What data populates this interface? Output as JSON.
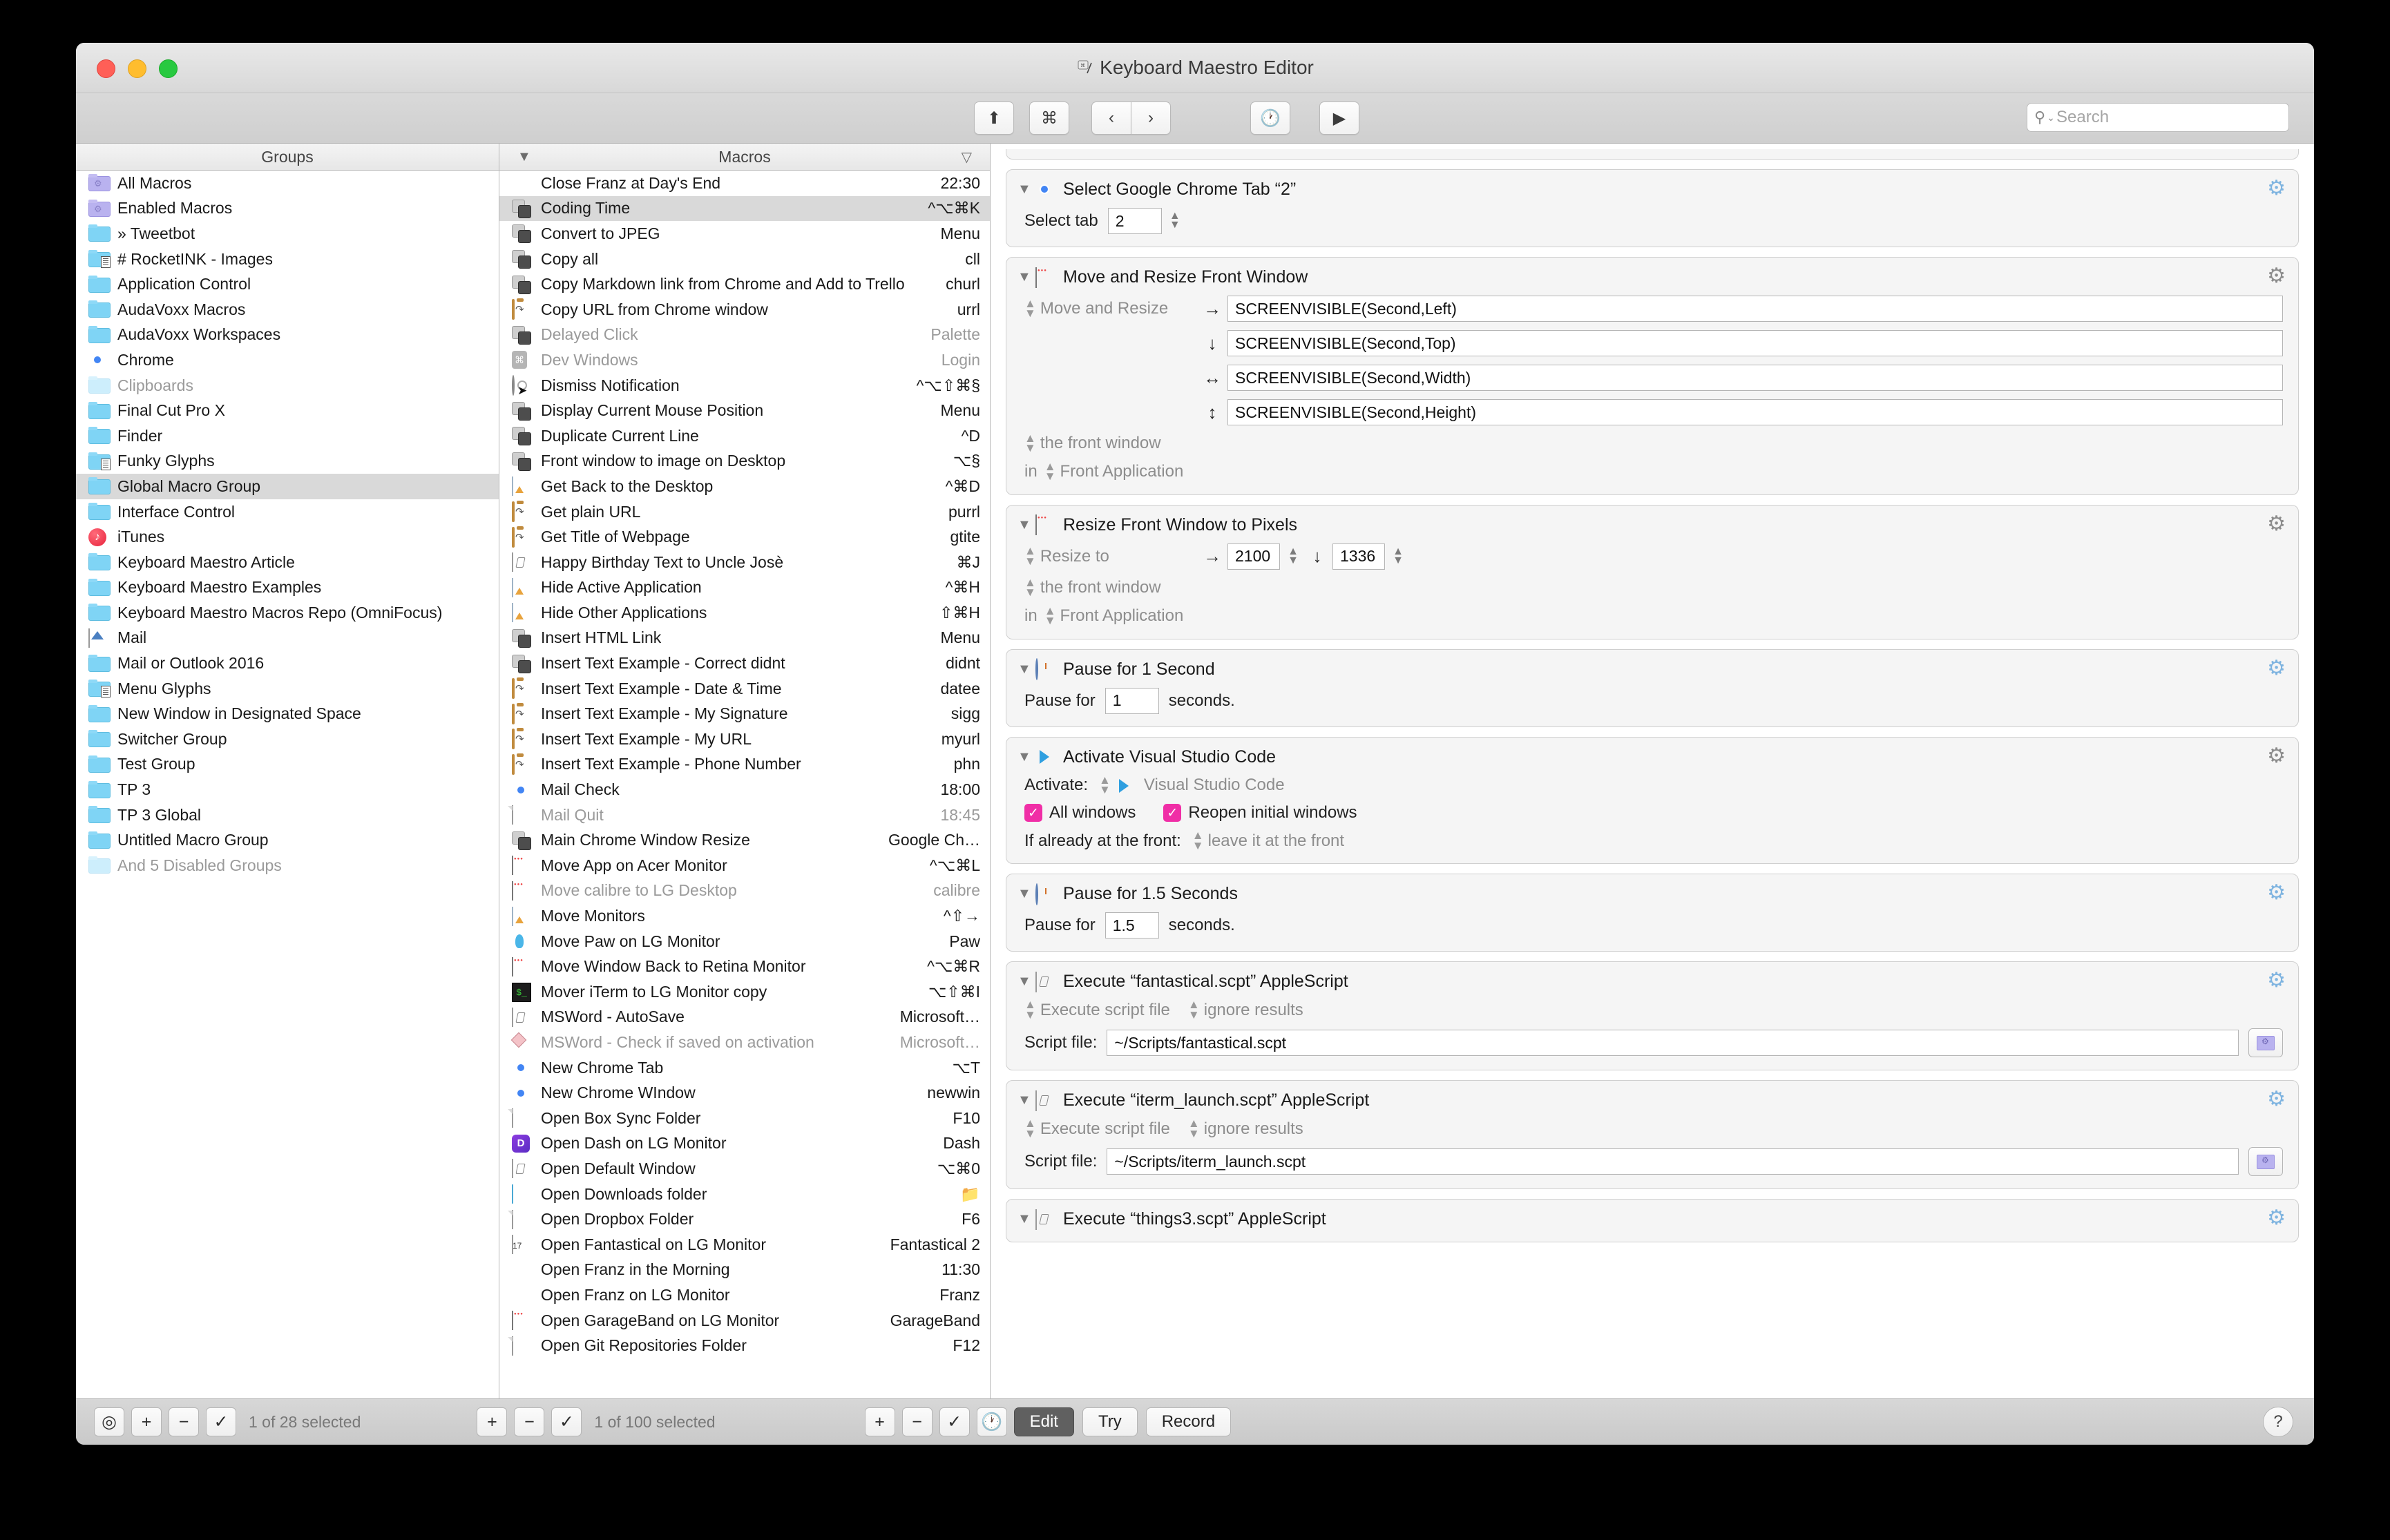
{
  "window": {
    "title": "Keyboard Maestro Editor",
    "app_icon": "keyboard-maestro-icon"
  },
  "toolbar": {
    "share_icon": "share-icon",
    "command_icon": "command-icon",
    "back_icon": "chevron-left-icon",
    "forward_icon": "chevron-right-icon",
    "clock_icon": "clock-icon",
    "play_icon": "play-icon",
    "search": {
      "value": "",
      "placeholder": "Search",
      "icon": "search-icon"
    }
  },
  "groups_column": {
    "header": "Groups",
    "items": [
      {
        "label": "All Macros",
        "icon": "folder-gear-purple",
        "dim": false,
        "selected": false
      },
      {
        "label": "Enabled Macros",
        "icon": "folder-gear-purple",
        "dim": false,
        "selected": false
      },
      {
        "label": "» Tweetbot",
        "icon": "folder-blue",
        "dim": false,
        "selected": false
      },
      {
        "label": "# RocketINK - Images",
        "icon": "folder-blue-doc",
        "dim": false,
        "selected": false
      },
      {
        "label": "Application Control",
        "icon": "folder-blue",
        "dim": false,
        "selected": false
      },
      {
        "label": "AudaVoxx Macros",
        "icon": "folder-blue",
        "dim": false,
        "selected": false
      },
      {
        "label": "AudaVoxx Workspaces",
        "icon": "folder-blue",
        "dim": false,
        "selected": false
      },
      {
        "label": "Chrome",
        "icon": "chrome-icon",
        "dim": false,
        "selected": false
      },
      {
        "label": "Clipboards",
        "icon": "folder-pale",
        "dim": true,
        "selected": false
      },
      {
        "label": "Final Cut Pro X",
        "icon": "folder-blue",
        "dim": false,
        "selected": false
      },
      {
        "label": "Finder",
        "icon": "folder-blue",
        "dim": false,
        "selected": false
      },
      {
        "label": "Funky Glyphs",
        "icon": "folder-blue-doc",
        "dim": false,
        "selected": false
      },
      {
        "label": "Global Macro Group",
        "icon": "folder-blue",
        "dim": false,
        "selected": true
      },
      {
        "label": "Interface Control",
        "icon": "folder-blue",
        "dim": false,
        "selected": false
      },
      {
        "label": "iTunes",
        "icon": "itunes-icon",
        "dim": false,
        "selected": false
      },
      {
        "label": "Keyboard Maestro Article",
        "icon": "folder-blue",
        "dim": false,
        "selected": false
      },
      {
        "label": "Keyboard Maestro Examples",
        "icon": "folder-blue",
        "dim": false,
        "selected": false
      },
      {
        "label": "Keyboard Maestro Macros Repo (OmniFocus)",
        "icon": "folder-blue",
        "dim": false,
        "selected": false
      },
      {
        "label": "Mail",
        "icon": "mail-icon",
        "dim": false,
        "selected": false
      },
      {
        "label": "Mail or Outlook 2016",
        "icon": "folder-blue",
        "dim": false,
        "selected": false
      },
      {
        "label": "Menu Glyphs",
        "icon": "folder-blue-doc",
        "dim": false,
        "selected": false
      },
      {
        "label": "New Window in Designated Space",
        "icon": "folder-blue",
        "dim": false,
        "selected": false
      },
      {
        "label": "Switcher Group",
        "icon": "folder-blue",
        "dim": false,
        "selected": false
      },
      {
        "label": "Test Group",
        "icon": "folder-blue",
        "dim": false,
        "selected": false
      },
      {
        "label": "TP 3",
        "icon": "folder-blue",
        "dim": false,
        "selected": false
      },
      {
        "label": "TP 3 Global",
        "icon": "folder-blue",
        "dim": false,
        "selected": false
      },
      {
        "label": "Untitled Macro Group",
        "icon": "folder-blue",
        "dim": false,
        "selected": false
      },
      {
        "label": "And 5 Disabled Groups",
        "icon": "folder-pale",
        "dim": true,
        "selected": false
      }
    ]
  },
  "macros_column": {
    "header": "Macros",
    "sort_left_icon": "sort-descending-icon",
    "sort_right_icon": "filter-icon",
    "items": [
      {
        "label": "Close Franz at Day's End",
        "trigger": "22:30",
        "icon": "franz-icon",
        "dim": false,
        "selected": false
      },
      {
        "label": "Coding Time",
        "trigger": "^⌥⌘K",
        "icon": "macro-keys-icon",
        "dim": false,
        "selected": true
      },
      {
        "label": "Convert to JPEG",
        "trigger": "Menu",
        "icon": "macro-keys-icon",
        "dim": false,
        "selected": false
      },
      {
        "label": "Copy all",
        "trigger": "cll",
        "icon": "macro-keys-icon",
        "dim": false,
        "selected": false
      },
      {
        "label": "Copy Markdown link from Chrome and Add to Trello",
        "trigger": "churl",
        "icon": "macro-keys-icon",
        "dim": false,
        "selected": false
      },
      {
        "label": "Copy URL from Chrome window",
        "trigger": "urrl",
        "icon": "clipboard-icon",
        "dim": false,
        "selected": false
      },
      {
        "label": "Delayed Click",
        "trigger": "Palette",
        "icon": "macro-keys-icon",
        "dim": true,
        "selected": false
      },
      {
        "label": "Dev Windows",
        "trigger": "Login",
        "icon": "command-key-icon",
        "dim": true,
        "selected": false
      },
      {
        "label": "Dismiss Notification",
        "trigger": "^⌥⇧⌘§",
        "icon": "notification-cursor-icon",
        "dim": false,
        "selected": false
      },
      {
        "label": "Display Current Mouse Position",
        "trigger": "Menu",
        "icon": "macro-keys-icon",
        "dim": false,
        "selected": false
      },
      {
        "label": "Duplicate Current Line",
        "trigger": "^D",
        "icon": "macro-keys-icon",
        "dim": false,
        "selected": false
      },
      {
        "label": "Front window to image on Desktop",
        "trigger": "⌥§",
        "icon": "macro-keys-icon",
        "dim": false,
        "selected": false
      },
      {
        "label": "Get Back to the Desktop",
        "trigger": "^⌘D",
        "icon": "app-icon",
        "dim": false,
        "selected": false
      },
      {
        "label": "Get plain URL",
        "trigger": "purrl",
        "icon": "clipboard-icon",
        "dim": false,
        "selected": false
      },
      {
        "label": "Get Title of Webpage",
        "trigger": "gtite",
        "icon": "clipboard-icon",
        "dim": false,
        "selected": false
      },
      {
        "label": "Happy Birthday Text to Uncle Josè",
        "trigger": "⌘J",
        "icon": "script-icon",
        "dim": false,
        "selected": false
      },
      {
        "label": "Hide Active Application",
        "trigger": "^⌘H",
        "icon": "app-icon",
        "dim": false,
        "selected": false
      },
      {
        "label": "Hide Other Applications",
        "trigger": "⇧⌘H",
        "icon": "app-icon",
        "dim": false,
        "selected": false
      },
      {
        "label": "Insert HTML Link",
        "trigger": "Menu",
        "icon": "macro-keys-icon",
        "dim": false,
        "selected": false
      },
      {
        "label": "Insert Text Example - Correct didnt",
        "trigger": "didnt",
        "icon": "macro-keys-icon",
        "dim": false,
        "selected": false
      },
      {
        "label": "Insert Text Example - Date & Time",
        "trigger": "datee",
        "icon": "clipboard-icon",
        "dim": false,
        "selected": false
      },
      {
        "label": "Insert Text Example - My Signature",
        "trigger": "sigg",
        "icon": "clipboard-icon",
        "dim": false,
        "selected": false
      },
      {
        "label": "Insert Text Example - My URL",
        "trigger": "myurl",
        "icon": "clipboard-icon",
        "dim": false,
        "selected": false
      },
      {
        "label": "Insert Text Example - Phone Number",
        "trigger": "phn",
        "icon": "clipboard-icon",
        "dim": false,
        "selected": false
      },
      {
        "label": "Mail Check",
        "trigger": "18:00",
        "icon": "chrome-icon",
        "dim": false,
        "selected": false
      },
      {
        "label": "Mail Quit",
        "trigger": "18:45",
        "icon": "page-icon",
        "dim": true,
        "selected": false
      },
      {
        "label": "Main Chrome Window Resize",
        "trigger": "Google Ch…",
        "icon": "macro-keys-icon",
        "dim": false,
        "selected": false
      },
      {
        "label": "Move App on Acer Monitor",
        "trigger": "^⌥⌘L",
        "icon": "window-icon",
        "dim": false,
        "selected": false
      },
      {
        "label": "Move calibre to LG Desktop",
        "trigger": "calibre",
        "icon": "window-icon",
        "dim": true,
        "selected": false
      },
      {
        "label": "Move Monitors",
        "trigger": "^⇧→",
        "icon": "app-icon",
        "dim": false,
        "selected": false
      },
      {
        "label": "Move Paw on LG Monitor",
        "trigger": "Paw",
        "icon": "paw-icon",
        "dim": false,
        "selected": false
      },
      {
        "label": "Move Window Back to Retina Monitor",
        "trigger": "^⌥⌘R",
        "icon": "window-icon",
        "dim": false,
        "selected": false
      },
      {
        "label": "Mover iTerm to LG Monitor copy",
        "trigger": "⌥⇧⌘I",
        "icon": "iterm-icon",
        "dim": false,
        "selected": false
      },
      {
        "label": "MSWord - AutoSave",
        "trigger": "Microsoft…",
        "icon": "script-icon",
        "dim": false,
        "selected": false
      },
      {
        "label": "MSWord - Check if saved on activation",
        "trigger": "Microsoft…",
        "icon": "msword-icon",
        "dim": true,
        "selected": false
      },
      {
        "label": "New Chrome Tab",
        "trigger": "⌥T",
        "icon": "chrome-icon",
        "dim": false,
        "selected": false
      },
      {
        "label": "New Chrome WIndow",
        "trigger": "newwin",
        "icon": "chrome-icon",
        "dim": false,
        "selected": false
      },
      {
        "label": "Open Box Sync Folder",
        "trigger": "F10",
        "icon": "page-icon",
        "dim": false,
        "selected": false
      },
      {
        "label": "Open Dash on LG Monitor",
        "trigger": "Dash",
        "icon": "dash-icon",
        "dim": false,
        "selected": false
      },
      {
        "label": "Open Default Window",
        "trigger": "⌥⌘0",
        "icon": "script-icon",
        "dim": false,
        "selected": false
      },
      {
        "label": "Open Downloads folder",
        "trigger": "📁",
        "icon": "downloads-folder-icon",
        "dim": false,
        "selected": false
      },
      {
        "label": "Open Dropbox Folder",
        "trigger": "F6",
        "icon": "page-icon",
        "dim": false,
        "selected": false
      },
      {
        "label": "Open Fantastical on LG Monitor",
        "trigger": "Fantastical 2",
        "icon": "calendar-icon",
        "dim": false,
        "selected": false
      },
      {
        "label": "Open Franz in the Morning",
        "trigger": "11:30",
        "icon": "franz-icon",
        "dim": false,
        "selected": false
      },
      {
        "label": "Open Franz on LG Monitor",
        "trigger": "Franz",
        "icon": "franz-icon",
        "dim": false,
        "selected": false
      },
      {
        "label": "Open GarageBand on LG Monitor",
        "trigger": "GarageBand",
        "icon": "window-icon",
        "dim": false,
        "selected": false
      },
      {
        "label": "Open Git Repositories Folder",
        "trigger": "F12",
        "icon": "page-icon",
        "dim": false,
        "selected": false
      }
    ]
  },
  "actions": [
    {
      "title": "Select Google Chrome Tab “2”",
      "icon": "chrome-icon",
      "gear_style": "blue",
      "fields": {
        "select_tab_label": "Select tab",
        "select_tab_value": "2"
      }
    },
    {
      "title": "Move and Resize Front Window",
      "icon": "window-icon",
      "gear_style": "gray",
      "fields": {
        "popup_label": "Move and Resize",
        "left_arrow": "→",
        "left_value": "SCREENVISIBLE(Second,Left)",
        "top_arrow": "↓",
        "top_value": "SCREENVISIBLE(Second,Top)",
        "width_arrow": "↔",
        "width_value": "SCREENVISIBLE(Second,Width)",
        "height_arrow": "↕",
        "height_value": "SCREENVISIBLE(Second,Height)",
        "target_window": "the front window",
        "in_label": "in",
        "target_app": "Front Application"
      }
    },
    {
      "title": "Resize Front Window to Pixels",
      "icon": "window-icon",
      "gear_style": "gray",
      "fields": {
        "popup_label": "Resize to",
        "width_arrow": "→",
        "width_value": "2100",
        "height_arrow": "↓",
        "height_value": "1336",
        "target_window": "the front window",
        "in_label": "in",
        "target_app": "Front Application"
      }
    },
    {
      "title": "Pause for 1 Second",
      "icon": "clock-icon",
      "gear_style": "blue",
      "fields": {
        "prefix": "Pause for",
        "value": "1",
        "suffix": "seconds."
      }
    },
    {
      "title": "Activate Visual Studio Code",
      "icon": "vscode-icon",
      "gear_style": "gray",
      "fields": {
        "activate_label": "Activate:",
        "app_name": "Visual Studio Code",
        "all_windows_label": "All windows",
        "all_windows_checked": true,
        "reopen_label": "Reopen initial windows",
        "reopen_checked": true,
        "front_label": "If already at the front:",
        "front_value": "leave it at the front"
      }
    },
    {
      "title": "Pause for 1.5 Seconds",
      "icon": "clock-icon",
      "gear_style": "blue",
      "fields": {
        "prefix": "Pause for",
        "value": "1.5",
        "suffix": "seconds."
      }
    },
    {
      "title": "Execute “fantastical.scpt” AppleScript",
      "icon": "script-icon",
      "gear_style": "blue",
      "fields": {
        "mode": "Execute script file",
        "results": "ignore results",
        "script_label": "Script file:",
        "script_path": "~/Scripts/fantastical.scpt",
        "browse_icon": "folder-browse-icon"
      }
    },
    {
      "title": "Execute “iterm_launch.scpt” AppleScript",
      "icon": "script-icon",
      "gear_style": "blue",
      "fields": {
        "mode": "Execute script file",
        "results": "ignore results",
        "script_label": "Script file:",
        "script_path": "~/Scripts/iterm_launch.scpt",
        "browse_icon": "folder-browse-icon"
      }
    },
    {
      "title": "Execute “things3.scpt” AppleScript",
      "icon": "script-icon",
      "gear_style": "blue",
      "fields": {}
    }
  ],
  "statusbar": {
    "groups_target_icon": "target-icon",
    "groups_add": "+",
    "groups_remove": "−",
    "groups_check": "✓",
    "groups_status": "1 of 28 selected",
    "macros_add": "+",
    "macros_remove": "−",
    "macros_check": "✓",
    "macros_status": "1 of 100 selected",
    "actions_add": "+",
    "actions_remove": "−",
    "actions_check": "✓",
    "actions_clock": "clock-icon",
    "edit_label": "Edit",
    "try_label": "Try",
    "record_label": "Record",
    "help_label": "?"
  }
}
